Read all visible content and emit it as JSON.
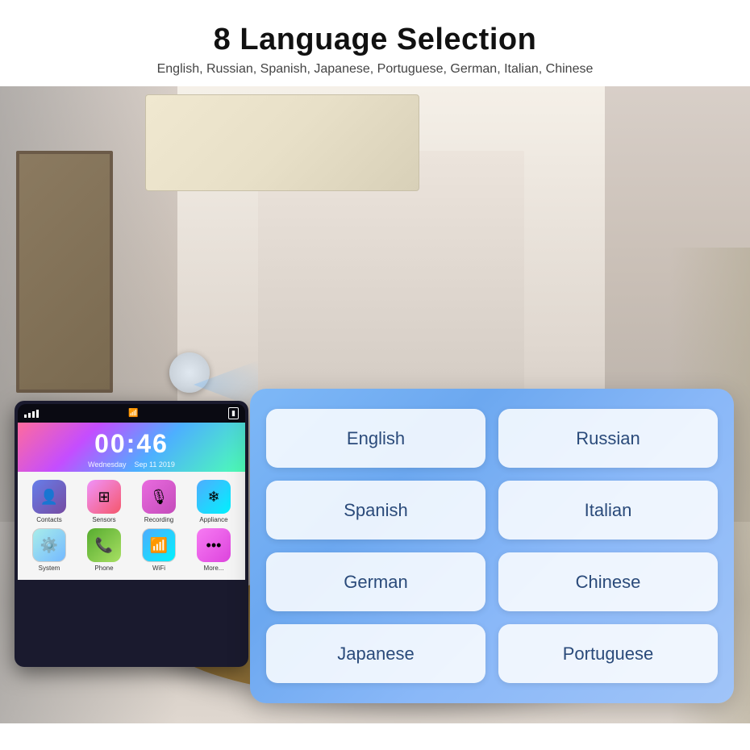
{
  "header": {
    "title": "8 Language Selection",
    "subtitle": "English, Russian, Spanish, Japanese, Portuguese, German, Italian, Chinese"
  },
  "phone": {
    "time": "00:46",
    "date_line1": "Wednesday",
    "date_line2": "Sep 11 2019",
    "apps": [
      {
        "label": "Contacts",
        "icon": "👤",
        "class": "app-contacts"
      },
      {
        "label": "Sensors",
        "icon": "⊞",
        "class": "app-sensors"
      },
      {
        "label": "Recording",
        "icon": "🎙",
        "class": "app-recording"
      },
      {
        "label": "Appliance",
        "icon": "❄",
        "class": "app-appliance"
      },
      {
        "label": "System",
        "icon": "⚙",
        "class": "app-system"
      },
      {
        "label": "Phone",
        "icon": "📞",
        "class": "app-phone"
      },
      {
        "label": "WiFi",
        "icon": "📶",
        "class": "app-wifi"
      },
      {
        "label": "More...",
        "icon": "•••",
        "class": "app-more"
      }
    ]
  },
  "languages": [
    {
      "id": "english",
      "label": "English"
    },
    {
      "id": "russian",
      "label": "Russian"
    },
    {
      "id": "spanish",
      "label": "Spanish"
    },
    {
      "id": "italian",
      "label": "Italian"
    },
    {
      "id": "german",
      "label": "German"
    },
    {
      "id": "chinese",
      "label": "Chinese"
    },
    {
      "id": "japanese",
      "label": "Japanese"
    },
    {
      "id": "portuguese",
      "label": "Portuguese"
    }
  ]
}
